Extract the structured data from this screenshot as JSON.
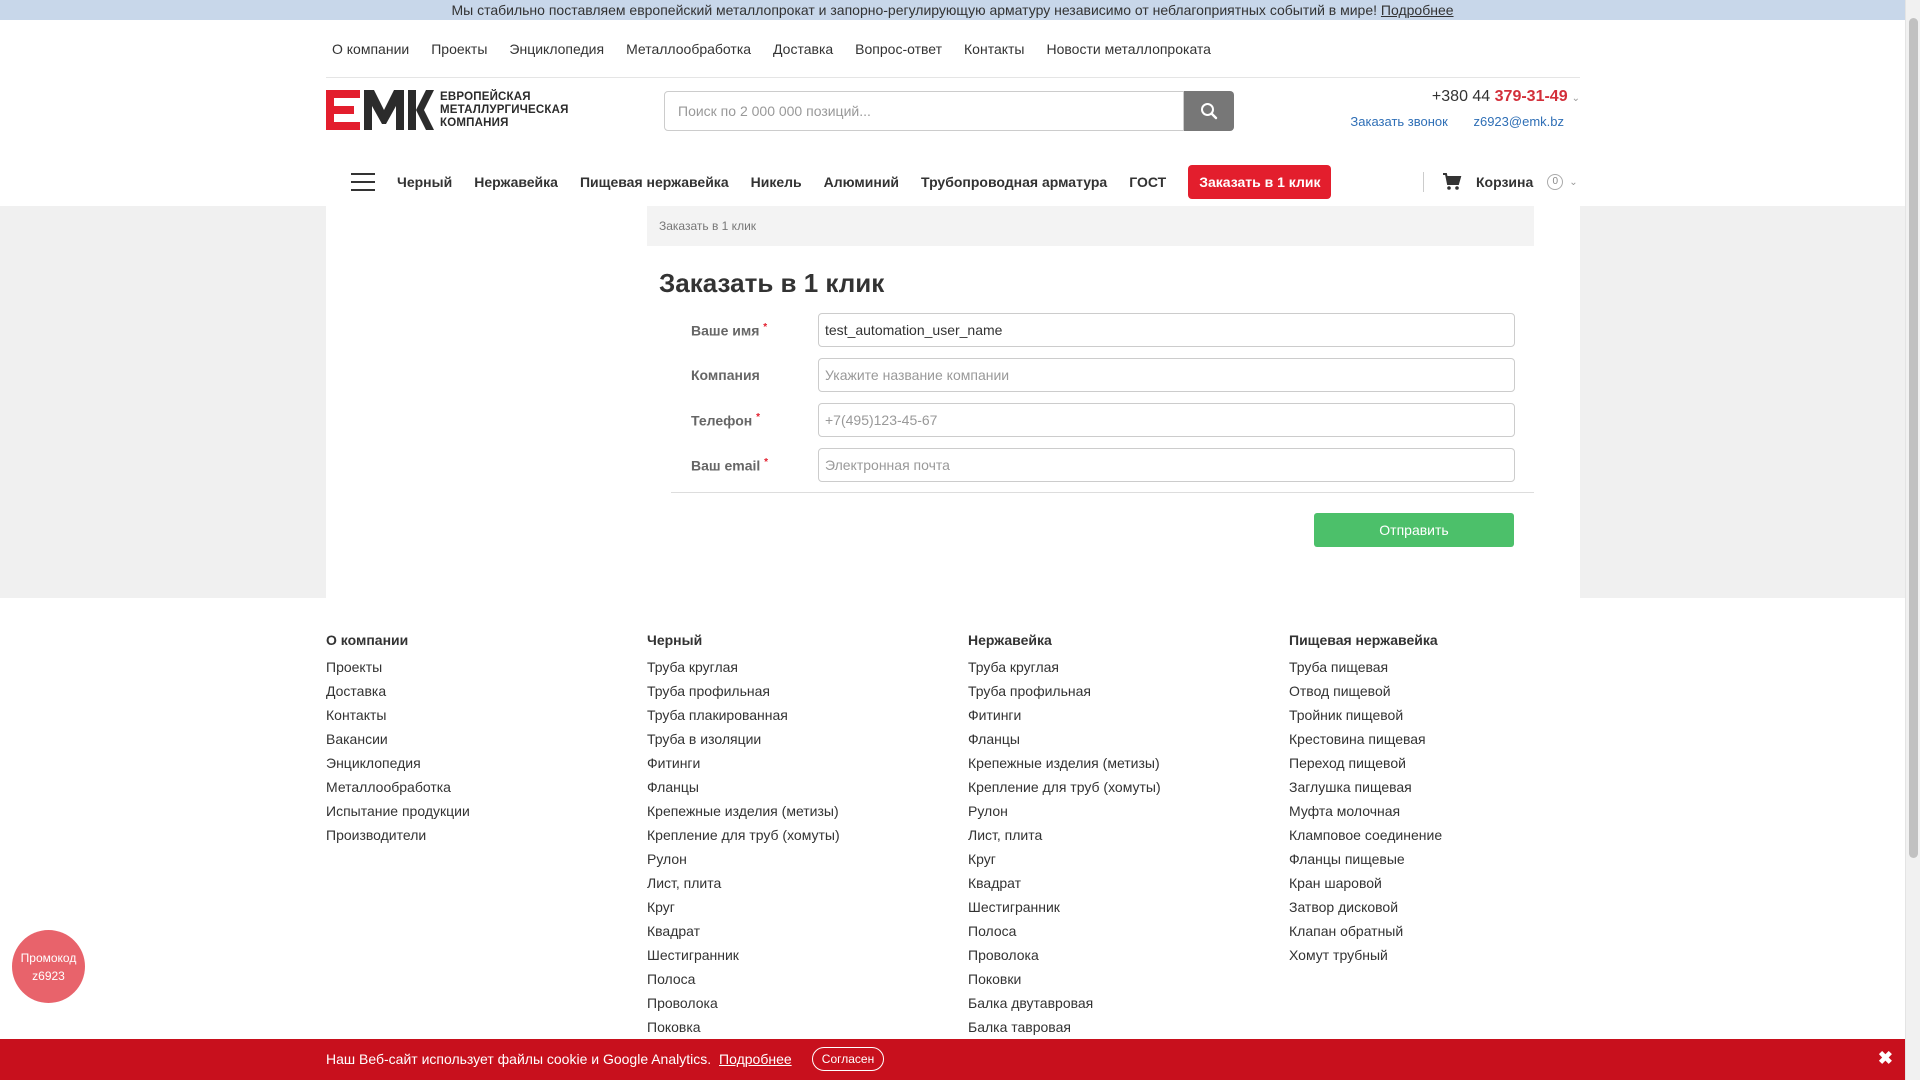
{
  "announcement": {
    "text": "Мы стабильно поставляем европейский металлопрокат и запорно-регулирующую арматуру независимо от неблагоприятных событий в мире!",
    "link": "Подробнее"
  },
  "topnav": [
    "О компании",
    "Проекты",
    "Энциклопедия",
    "Металлообработка",
    "Доставка",
    "Вопрос-ответ",
    "Контакты",
    "Новости металлопроката"
  ],
  "logo": {
    "line1": "ЕВРОПЕЙСКАЯ",
    "line2": "МЕТАЛЛУРГИЧЕСКАЯ",
    "line3": "КОМПАНИЯ"
  },
  "search": {
    "placeholder": "Поиск по 2 000 000 позиций..."
  },
  "phone": {
    "prefix": "+380 44",
    "number": "379-31-49"
  },
  "contacts": {
    "callback": "Заказать звонок",
    "email": "z6923@emk.bz"
  },
  "catnav": {
    "items": [
      "Черный",
      "Нержавейка",
      "Пищевая нержавейка",
      "Никель",
      "Алюминий",
      "Трубопроводная арматура",
      "ГОСТ"
    ],
    "order_button": "Заказать в 1 клик"
  },
  "cart": {
    "label": "Корзина",
    "count": "0"
  },
  "breadcrumb": "Заказать в 1 клик",
  "form": {
    "title": "Заказать в 1 клик",
    "name_label": "Ваше имя",
    "name_value": "test_automation_user_name",
    "company_label": "Компания",
    "company_placeholder": "Укажите название компании",
    "phone_label": "Телефон",
    "phone_placeholder": "+7(495)123-45-67",
    "email_label": "Ваш email",
    "email_placeholder": "Электронная почта",
    "required_mark": "*",
    "submit": "Отправить"
  },
  "footer": {
    "col1": {
      "title": "О компании",
      "items": [
        "Проекты",
        "Доставка",
        "Контакты",
        "Вакансии",
        "Энциклопедия",
        "Металлообработка",
        "Испытание продукции",
        "Производители"
      ]
    },
    "col2": {
      "title": "Черный",
      "items": [
        "Труба круглая",
        "Труба профильная",
        "Труба плакированная",
        "Труба в изоляции",
        "Фитинги",
        "Фланцы",
        "Крепежные изделия (метизы)",
        "Крепление для труб (хомуты)",
        "Рулон",
        "Лист, плита",
        "Круг",
        "Квадрат",
        "Шестигранник",
        "Полоса",
        "Проволока",
        "Поковка"
      ]
    },
    "col3": {
      "title": "Нержавейка",
      "items": [
        "Труба круглая",
        "Труба профильная",
        "Фитинги",
        "Фланцы",
        "Крепежные изделия (метизы)",
        "Крепление для труб (хомуты)",
        "Рулон",
        "Лист, плита",
        "Круг",
        "Квадрат",
        "Шестигранник",
        "Полоса",
        "Проволока",
        "Поковки",
        "Балка двутавровая",
        "Балка тавровая"
      ]
    },
    "col4": {
      "title": "Пищевая нержавейка",
      "items": [
        "Труба пищевая",
        "Отвод пищевой",
        "Тройник пищевой",
        "Крестовина пищевая",
        "Переход пищевой",
        "Заглушка пищевая",
        "Муфта молочная",
        "Кламповое соединение",
        "Фланцы пищевые",
        "Кран шаровой",
        "Затвор дисковой",
        "Клапан обратный",
        "Хомут трубный"
      ]
    }
  },
  "promo": {
    "line1": "Промокод",
    "line2": "z6923"
  },
  "cookie": {
    "text": "Наш Веб-сайт использует файлы cookie и Google Analytics.",
    "link": "Подробнее",
    "accept": "Согласен",
    "close": "✖"
  },
  "colors": {
    "accent_red": "#e31e2d",
    "submit_green": "#4cc06a",
    "link_blue": "#2f6fb6",
    "announce_bg": "#c8d7ea"
  }
}
